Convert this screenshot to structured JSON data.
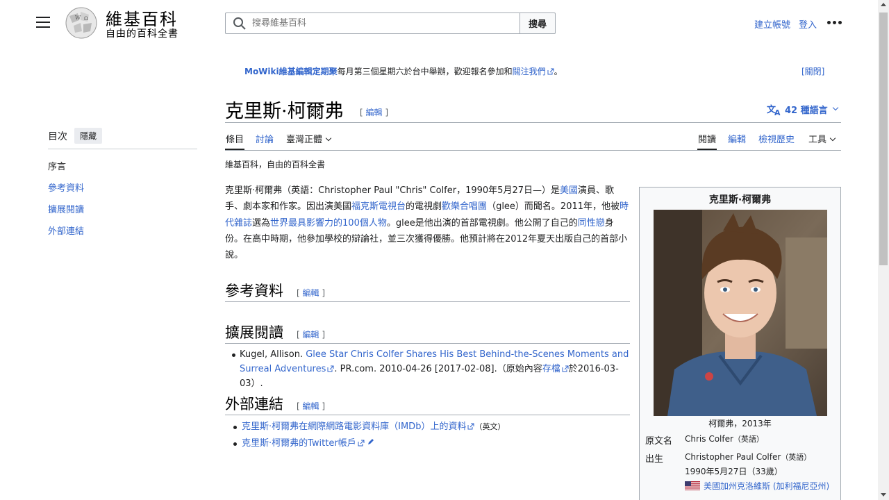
{
  "header": {
    "logo_title": "維基百科",
    "logo_tagline": "自由的百科全書",
    "search_placeholder": "搜尋維基百科",
    "search_button": "搜尋",
    "create_account": "建立帳號",
    "login": "登入"
  },
  "banner": {
    "link1": "MoWiki維基編輯定期聚",
    "text1": "每月第三個星期六於台中舉辦，歡迎報名參加和",
    "link2": "關注我們",
    "text2": "。",
    "close": "[關閉]"
  },
  "toc": {
    "title": "目次",
    "hide": "隱藏",
    "items": [
      "序言",
      "參考資料",
      "擴展閱讀",
      "外部連結"
    ]
  },
  "page": {
    "title": "克里斯·柯爾弗",
    "title_edit": "[ 編輯 ]",
    "languages": "42 種語言",
    "tabs_left": [
      "條目",
      "討論",
      "臺灣正體"
    ],
    "tabs_right": [
      "閱讀",
      "編輯",
      "檢視歷史",
      "工具"
    ],
    "tagline": "維基百科，自由的百科全書"
  },
  "article": {
    "p1": "克里斯·柯爾弗（英語：Christopher Paul \"Chris\" Colfer，1990年5月27日—）是",
    "l_usa": "美國",
    "p2": "演員、歌手、劇本家和作家。因出演美國",
    "l_fox": "福克斯電視台",
    "p3": "的電視劇",
    "l_glee": "歡樂合唱團",
    "p4": "（glee）而聞名。2011年，他被",
    "l_time": "時代雜誌",
    "p5": "選為",
    "l_top100": "世界最具影響力的100個人物",
    "p6": "。glee是他出演的首部電視劇。他公開了自己的",
    "l_gay": "同性戀",
    "p7": "身份。在高中時期，他參加學校的辯論社，並三次獲得優勝。他預計將在2012年夏天出版自己的首部小說。"
  },
  "sections": {
    "refs": "參考資料",
    "further": "擴展閱讀",
    "external": "外部連結",
    "edit": "編輯"
  },
  "further": {
    "author": "Kugel, Allison.",
    "link": "Glee Star Chris Colfer Shares His Best Behind-the-Scenes Moments and Surreal Adventures",
    "rest": ". PR.com. 2010-04-26 [2017-02-08].（原始內容",
    "archive": "存檔",
    "rest2": "於2016-03-03）."
  },
  "external_links": [
    {
      "text": "克里斯·柯爾弗在網際網路電影資料庫（IMDb）上的資料",
      "note": "（英文）"
    },
    {
      "text": "克里斯·柯爾弗的Twitter帳戶",
      "note": ""
    }
  ],
  "infobox": {
    "title": "克里斯·柯爾弗",
    "caption": "柯爾弗，2013年",
    "label_name": "原文名",
    "name": "Chris Colfer",
    "label_born": "出生",
    "born_name": "Christopher Paul Colfer",
    "born_date": "1990年5月27日（33歲）",
    "born_place": "美國加州克洛維斯 (加利福尼亞州)",
    "lang_note": "（英語）"
  }
}
